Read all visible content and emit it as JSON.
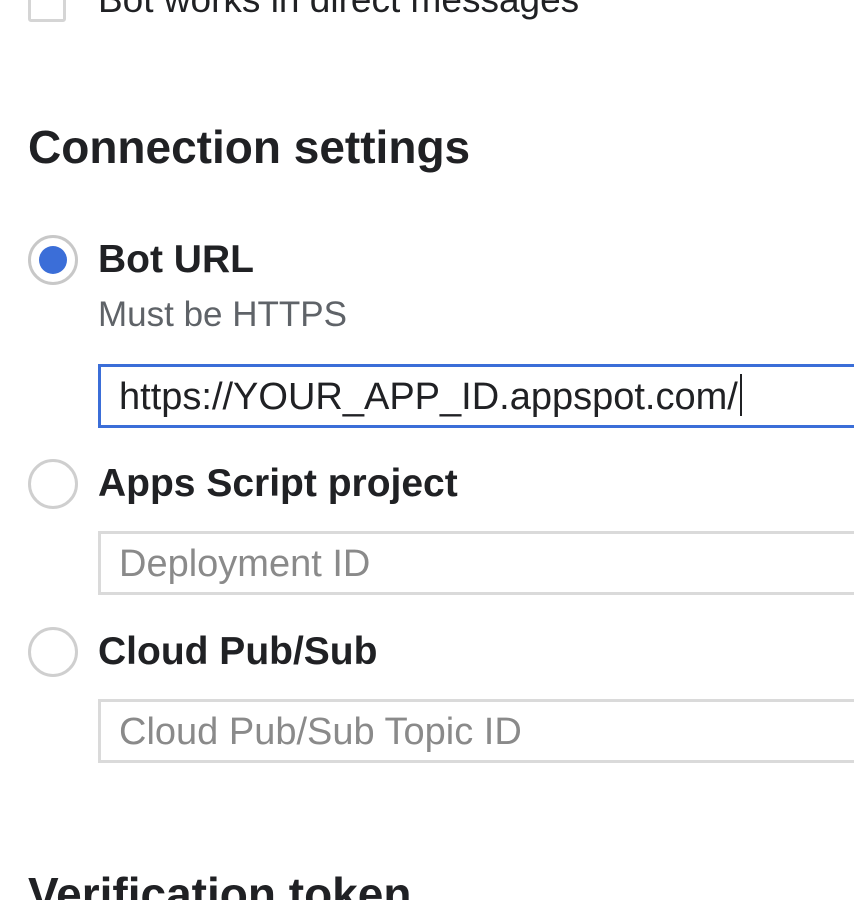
{
  "dm_option": {
    "label": "Bot works in direct messages",
    "checked": false
  },
  "connection_settings": {
    "title": "Connection settings",
    "options": [
      {
        "label": "Bot URL",
        "helper": "Must be HTTPS",
        "selected": true,
        "input": {
          "value": "https://YOUR_APP_ID.appspot.com/",
          "placeholder": ""
        }
      },
      {
        "label": "Apps Script project",
        "selected": false,
        "input": {
          "value": "",
          "placeholder": "Deployment ID"
        }
      },
      {
        "label": "Cloud Pub/Sub",
        "selected": false,
        "input": {
          "value": "",
          "placeholder": "Cloud Pub/Sub Topic ID"
        }
      }
    ]
  },
  "verification": {
    "title": "Verification token"
  },
  "colors": {
    "accent": "#3b6ed8",
    "text": "#202124",
    "secondary_text": "#5f6368",
    "placeholder": "#8a8a8a",
    "border": "#dadada"
  }
}
